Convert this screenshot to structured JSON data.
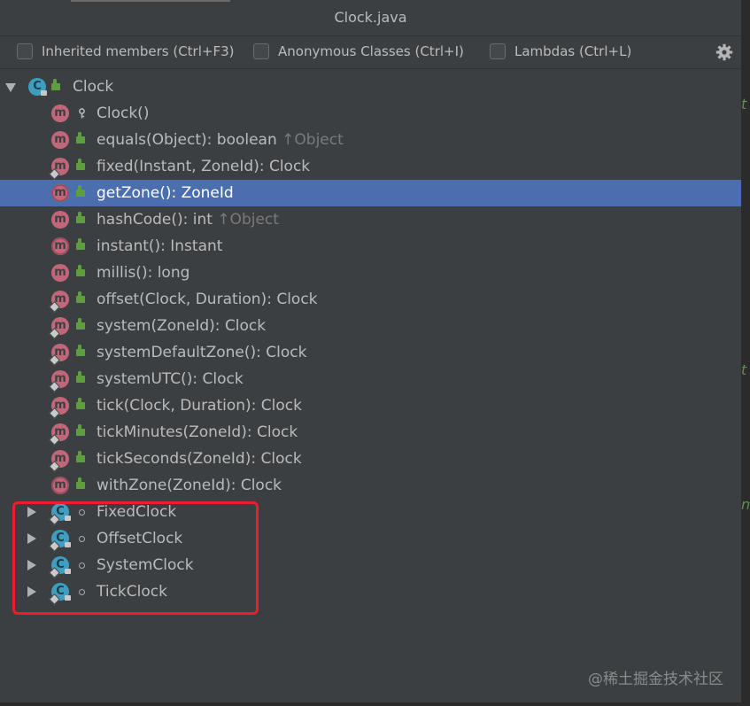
{
  "window": {
    "title": "Clock.java"
  },
  "filters": [
    {
      "label": "Inherited members (Ctrl+F3)",
      "checked": false
    },
    {
      "label": "Anonymous Classes (Ctrl+I)",
      "checked": false
    },
    {
      "label": "Lambdas (Ctrl+L)",
      "checked": false
    }
  ],
  "toolbar": {
    "settings_icon": "gear-icon"
  },
  "tree": {
    "root": {
      "label": "Clock",
      "expanded": true,
      "icon": "abstract-class-icon"
    },
    "members": [
      {
        "label": "Clock()",
        "inherited": "",
        "icon": "method-icon",
        "visibility": "protected"
      },
      {
        "label": "equals(Object): boolean",
        "inherited": "↑Object",
        "icon": "method-icon",
        "visibility": "public"
      },
      {
        "label": "fixed(Instant, ZoneId): Clock",
        "inherited": "",
        "icon": "static-method-icon",
        "visibility": "public"
      },
      {
        "label": "getZone(): ZoneId",
        "inherited": "",
        "icon": "abstract-method-icon",
        "visibility": "public",
        "selected": true
      },
      {
        "label": "hashCode(): int",
        "inherited": "↑Object",
        "icon": "method-icon",
        "visibility": "public"
      },
      {
        "label": "instant(): Instant",
        "inherited": "",
        "icon": "abstract-method-icon",
        "visibility": "public"
      },
      {
        "label": "millis(): long",
        "inherited": "",
        "icon": "method-icon",
        "visibility": "public"
      },
      {
        "label": "offset(Clock, Duration): Clock",
        "inherited": "",
        "icon": "static-method-icon",
        "visibility": "public"
      },
      {
        "label": "system(ZoneId): Clock",
        "inherited": "",
        "icon": "static-method-icon",
        "visibility": "public"
      },
      {
        "label": "systemDefaultZone(): Clock",
        "inherited": "",
        "icon": "static-method-icon",
        "visibility": "public"
      },
      {
        "label": "systemUTC(): Clock",
        "inherited": "",
        "icon": "static-method-icon",
        "visibility": "public"
      },
      {
        "label": "tick(Clock, Duration): Clock",
        "inherited": "",
        "icon": "static-method-icon",
        "visibility": "public"
      },
      {
        "label": "tickMinutes(ZoneId): Clock",
        "inherited": "",
        "icon": "static-method-icon",
        "visibility": "public"
      },
      {
        "label": "tickSeconds(ZoneId): Clock",
        "inherited": "",
        "icon": "static-method-icon",
        "visibility": "public"
      },
      {
        "label": "withZone(ZoneId): Clock",
        "inherited": "",
        "icon": "abstract-method-icon",
        "visibility": "public"
      }
    ],
    "nested_classes": [
      {
        "label": "FixedClock",
        "expanded": false,
        "icon": "static-final-class-icon",
        "visibility": "package-private"
      },
      {
        "label": "OffsetClock",
        "expanded": false,
        "icon": "static-final-class-icon",
        "visibility": "package-private"
      },
      {
        "label": "SystemClock",
        "expanded": false,
        "icon": "static-final-class-icon",
        "visibility": "package-private"
      },
      {
        "label": "TickClock",
        "expanded": false,
        "icon": "static-final-class-icon",
        "visibility": "package-private"
      }
    ]
  },
  "annotation": {
    "color": "#e8202a"
  },
  "watermark": {
    "text": "@稀土掘金技术社区"
  },
  "colors": {
    "background": "#3c3f41",
    "selection": "#4b6eaf",
    "method_icon": "#c2667a",
    "class_icon": "#3f9ebf",
    "public_lock": "#5f9e3f"
  }
}
